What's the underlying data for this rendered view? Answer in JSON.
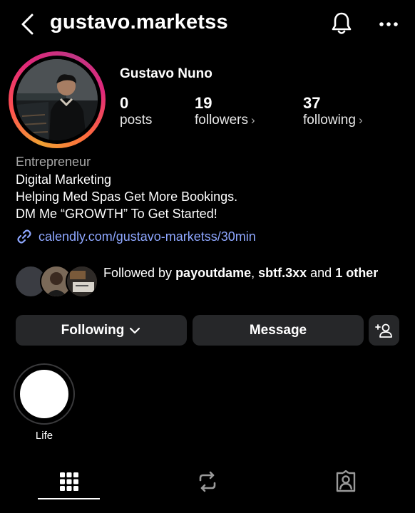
{
  "header": {
    "username": "gustavo.marketss",
    "icons": {
      "back": "chevron-left-icon",
      "notifications": "bell-icon",
      "more": "more-horizontal-icon"
    }
  },
  "profile": {
    "display_name": "Gustavo Nuno",
    "stats": [
      {
        "value": "0",
        "label": "posts"
      },
      {
        "value": "19",
        "label": "followers"
      },
      {
        "value": "37",
        "label": "following"
      }
    ],
    "category": "Entrepreneur",
    "bio_lines": [
      "Digital Marketing",
      "Helping Med Spas Get More Bookings.",
      "DM Me “GROWTH” To Get Started!"
    ],
    "link": "calendly.com/gustavo-marketss/30min"
  },
  "followed_by": {
    "prefix": "Followed by ",
    "user1": "payoutdame",
    "separator": ", ",
    "user2": "sbtf.3xx",
    "middle": " and ",
    "rest": "1 other"
  },
  "actions": {
    "following_label": "Following",
    "message_label": "Message"
  },
  "highlights": [
    {
      "label": "Life"
    }
  ],
  "tabs": [
    {
      "icon": "grid-icon",
      "active": true
    },
    {
      "icon": "reels-remix-icon",
      "active": false
    },
    {
      "icon": "tagged-icon",
      "active": false
    }
  ],
  "colors": {
    "background": "#000000",
    "button_bg": "#262729",
    "link": "#8ea7ff",
    "muted_text": "#a7a7a7"
  }
}
